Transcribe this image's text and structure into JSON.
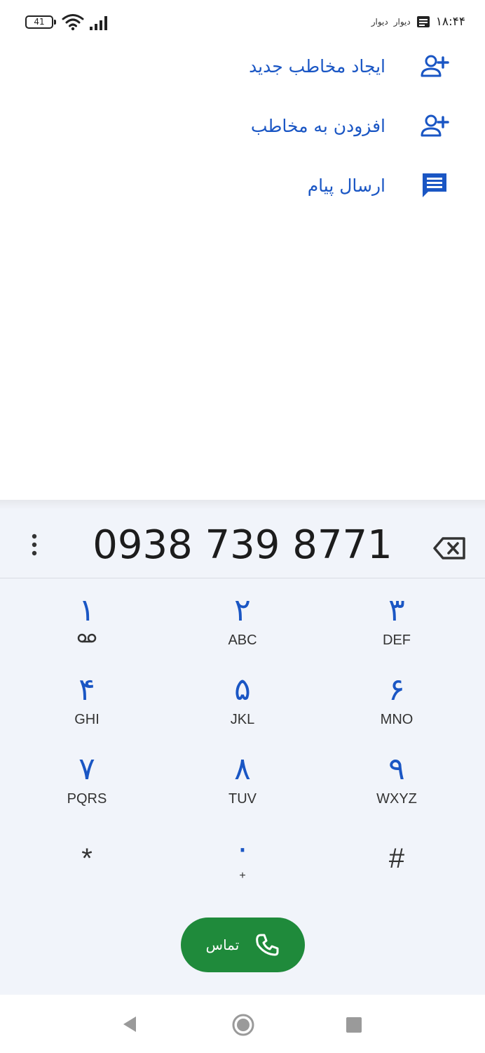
{
  "status_bar": {
    "battery": "41",
    "notif_1": "دیوار",
    "notif_2": "دیوار",
    "clock": "۱۸:۴۴"
  },
  "actions": [
    {
      "label": "ایجاد مخاطب جدید",
      "icon": "add-person-icon"
    },
    {
      "label": "افزودن به مخاطب",
      "icon": "add-person-icon"
    },
    {
      "label": "ارسال پیام",
      "icon": "message-icon"
    }
  ],
  "dialpad": {
    "number": "0938 739 8771",
    "keys": [
      {
        "digit": "۱",
        "letters": ""
      },
      {
        "digit": "۲",
        "letters": "ABC"
      },
      {
        "digit": "۳",
        "letters": "DEF"
      },
      {
        "digit": "۴",
        "letters": "GHI"
      },
      {
        "digit": "۵",
        "letters": "JKL"
      },
      {
        "digit": "۶",
        "letters": "MNO"
      },
      {
        "digit": "۷",
        "letters": "PQRS"
      },
      {
        "digit": "۸",
        "letters": "TUV"
      },
      {
        "digit": "۹",
        "letters": "WXYZ"
      },
      {
        "digit": "*",
        "letters": ""
      },
      {
        "digit": "۰",
        "letters": "+"
      },
      {
        "digit": "#",
        "letters": ""
      }
    ],
    "call_label": "تماس"
  },
  "colors": {
    "accent": "#1a56c4",
    "call_green": "#1f8a3b",
    "dialpad_bg": "#f1f4fa"
  }
}
